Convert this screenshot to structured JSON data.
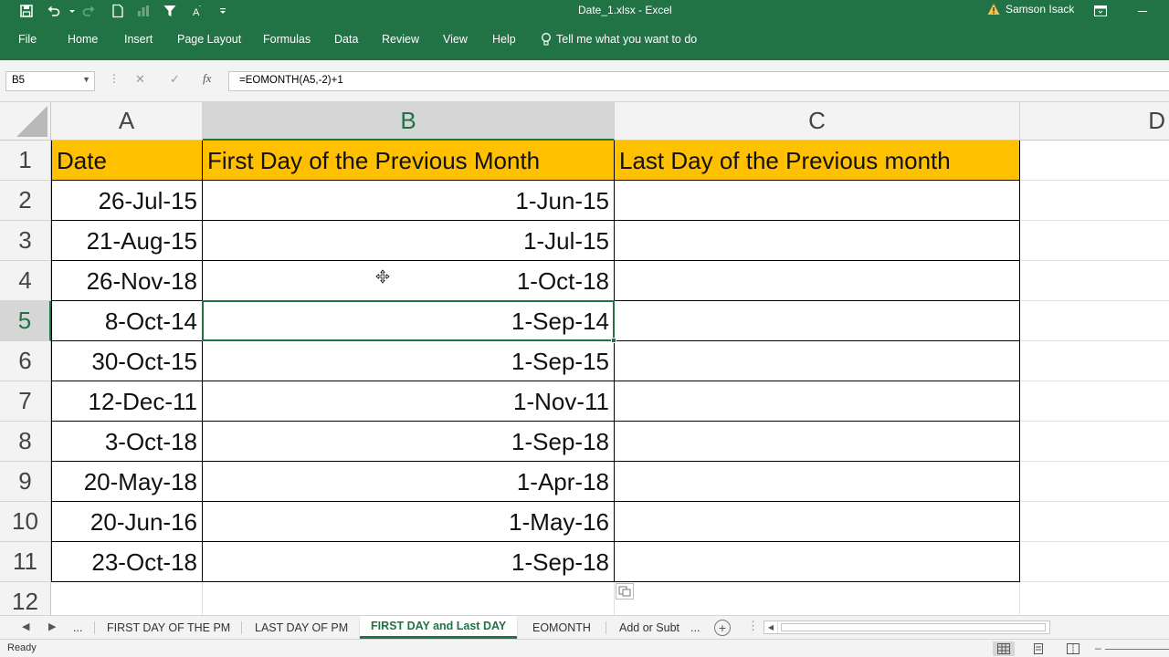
{
  "window": {
    "title": "Date_1.xlsx  -  Excel",
    "user": "Samson Isack"
  },
  "ribbon": {
    "tabs": [
      "File",
      "Home",
      "Insert",
      "Page Layout",
      "Formulas",
      "Data",
      "Review",
      "View",
      "Help"
    ],
    "tell_me": "Tell me what you want to do"
  },
  "formula_bar": {
    "name_box": "B5",
    "formula": "=EOMONTH(A5,-2)+1",
    "fx": "fx"
  },
  "sheet": {
    "columns": [
      "A",
      "B",
      "C",
      "D"
    ],
    "rows": [
      "1",
      "2",
      "3",
      "4",
      "5",
      "6",
      "7",
      "8",
      "9",
      "10",
      "11",
      "12"
    ],
    "headers": {
      "a": "Date",
      "b": "First Day of the Previous Month",
      "c": "Last Day of the Previous month"
    },
    "data": [
      {
        "date": "26-Jul-15",
        "first_day": "1-Jun-15",
        "last_day": ""
      },
      {
        "date": "21-Aug-15",
        "first_day": "1-Jul-15",
        "last_day": ""
      },
      {
        "date": "26-Nov-18",
        "first_day": "1-Oct-18",
        "last_day": ""
      },
      {
        "date": "8-Oct-14",
        "first_day": "1-Sep-14",
        "last_day": ""
      },
      {
        "date": "30-Oct-15",
        "first_day": "1-Sep-15",
        "last_day": ""
      },
      {
        "date": "12-Dec-11",
        "first_day": "1-Nov-11",
        "last_day": ""
      },
      {
        "date": "3-Oct-18",
        "first_day": "1-Sep-18",
        "last_day": ""
      },
      {
        "date": "20-May-18",
        "first_day": "1-Apr-18",
        "last_day": ""
      },
      {
        "date": "20-Jun-16",
        "first_day": "1-May-16",
        "last_day": ""
      },
      {
        "date": "23-Oct-18",
        "first_day": "1-Sep-18",
        "last_day": ""
      }
    ],
    "selected_cell": "B5",
    "header_fill": "#ffc000"
  },
  "sheet_tabs": {
    "overflow": "...",
    "tabs": [
      "FIRST DAY OF THE PM",
      "LAST DAY OF PM",
      "FIRST DAY and Last DAY",
      "EOMONTH",
      "Add or Subt"
    ],
    "active": "FIRST DAY and Last DAY",
    "more": "..."
  },
  "status_bar": {
    "status": "Ready"
  },
  "colors": {
    "excel_green": "#217346",
    "header_fill": "#ffc000"
  }
}
